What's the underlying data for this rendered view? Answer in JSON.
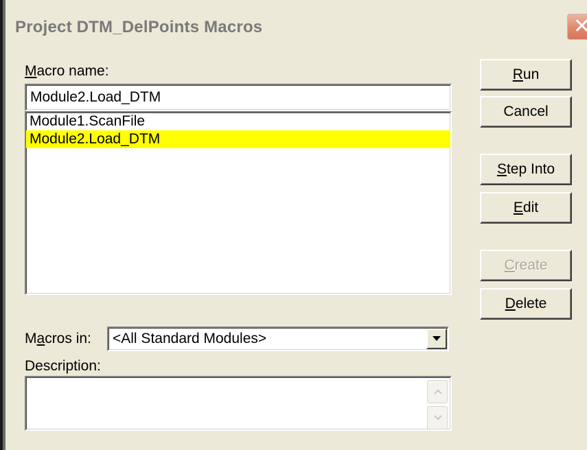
{
  "window": {
    "title": "Project DTM_DelPoints Macros",
    "close_glyph": "✕"
  },
  "macro_name": {
    "label_mnemonic": "M",
    "label_rest": "acro name:",
    "value": "Module2.Load_DTM"
  },
  "macro_list": {
    "items": [
      {
        "label": "Module1.ScanFile",
        "selected": false
      },
      {
        "label": "Module2.Load_DTM",
        "selected": true
      }
    ],
    "selection_color": "#ffff00"
  },
  "buttons": {
    "run": {
      "mnemonic": "R",
      "rest": "un"
    },
    "cancel": {
      "label": "Cancel"
    },
    "step_into": {
      "mnemonic": "S",
      "rest": "tep Into"
    },
    "edit": {
      "mnemonic": "E",
      "rest": "dit"
    },
    "create": {
      "mnemonic": "C",
      "rest": "reate",
      "enabled": false
    },
    "delete": {
      "mnemonic": "D",
      "rest": "elete"
    }
  },
  "macros_in": {
    "label_before": "M",
    "label_mnemonic": "a",
    "label_after": "cros in:",
    "selected": "<All Standard Modules>"
  },
  "description": {
    "label": "Description:",
    "value": ""
  },
  "icons": {
    "close": "close-icon",
    "dropdown": "chevron-down-icon",
    "scroll_up": "scroll-up-arrow-icon",
    "scroll_down": "scroll-down-arrow-icon"
  },
  "colors": {
    "dialog_bg": "#ece9d8",
    "close_button": "#e08a6e",
    "disabled_text": "#aca899"
  }
}
